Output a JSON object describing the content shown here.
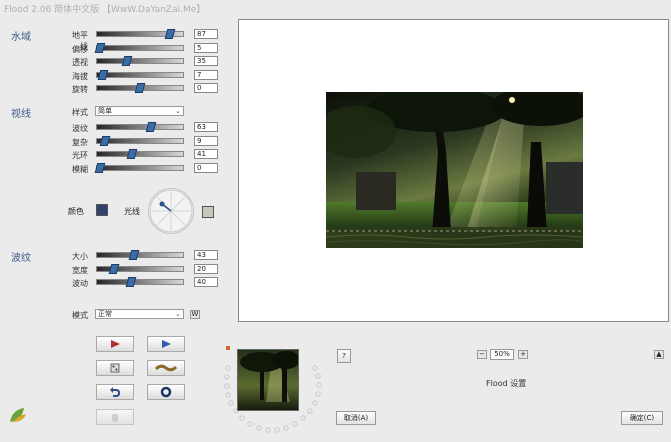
{
  "window": {
    "title": "Flood 2.06 简体中文版 【WwW.DaYanZai.Me】"
  },
  "water": {
    "section_label": "水域",
    "params": [
      {
        "label": "地平线",
        "value": "87",
        "level": 0.85
      },
      {
        "label": "偏移",
        "value": "5",
        "level": 0.03
      },
      {
        "label": "透视",
        "value": "35",
        "level": 0.35
      },
      {
        "label": "海拔",
        "value": "7",
        "level": 0.07
      },
      {
        "label": "旋转",
        "value": "0",
        "level": 0.5
      }
    ]
  },
  "view": {
    "section_label": "视线",
    "style_label": "样式",
    "style_value": "简单",
    "params": [
      {
        "label": "波纹",
        "value": "63",
        "level": 0.63
      },
      {
        "label": "复杂",
        "value": "9",
        "level": 0.09
      },
      {
        "label": "光环",
        "value": "41",
        "level": 0.41
      },
      {
        "label": "模糊",
        "value": "0",
        "level": 0.0
      }
    ],
    "color_label": "颜色",
    "light_label": "光线",
    "color_swatch": "#31456c",
    "light_swatch": "#c9c7bb"
  },
  "ripple": {
    "section_label": "波纹",
    "params": [
      {
        "label": "大小",
        "value": "43",
        "level": 0.43
      },
      {
        "label": "宽度",
        "value": "20",
        "level": 0.2
      },
      {
        "label": "波动",
        "value": "40",
        "level": 0.4
      }
    ],
    "mode_label": "模式",
    "mode_value": "正常",
    "mode_extra": "W"
  },
  "bottom": {
    "help_label": "?",
    "zoom_minus": "−",
    "zoom_value": "50%",
    "zoom_plus": "+",
    "plugin_label": "Flood 设置",
    "cancel_label": "取消(A)",
    "ok_label": "确定(C)",
    "top_btn": "▲"
  },
  "colors": {
    "section_text": "#3a5a8a",
    "thumb": "#3a6da6"
  }
}
